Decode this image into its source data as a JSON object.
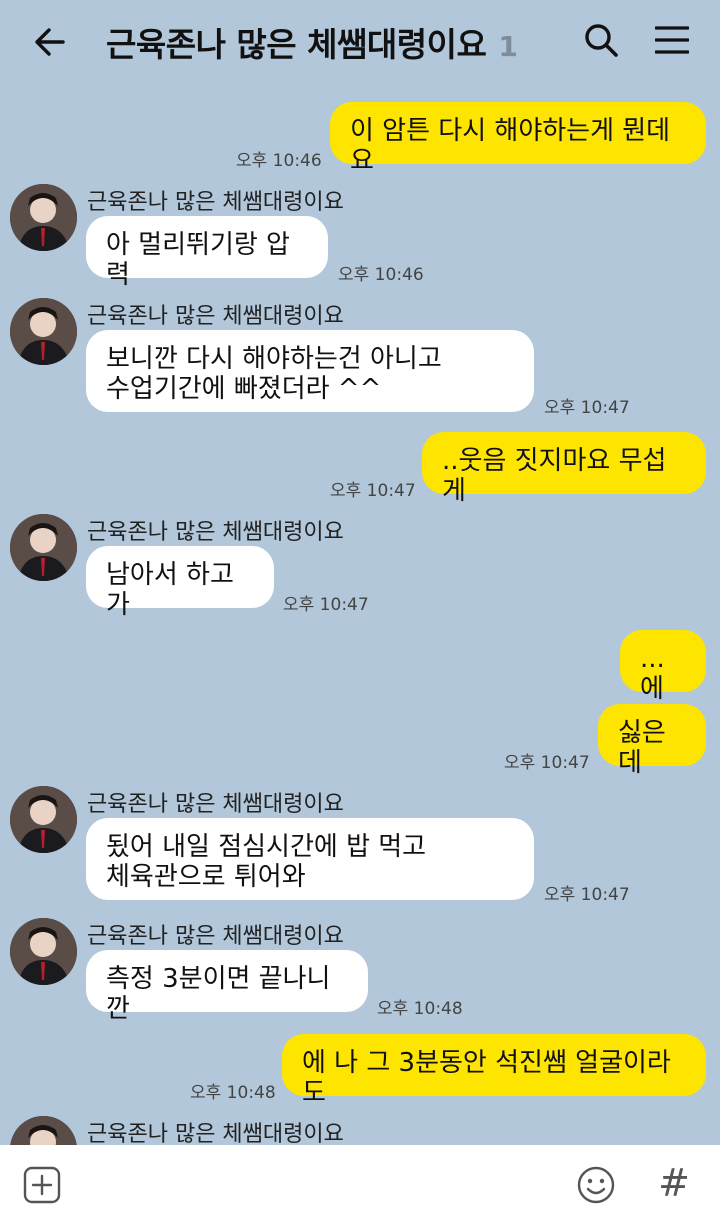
{
  "header": {
    "title": "근육존나 많은 체쌤대령이요",
    "member_count": "1"
  },
  "messages": [
    {
      "side": "me",
      "text": "이 암튼 다시 해야하는게 뭔데요",
      "time": "오후 10:46"
    },
    {
      "side": "them",
      "sender": "근육존나 많은 체쌤대령이요",
      "text": "아 멀리뛰기랑 압력",
      "time": "오후 10:46"
    },
    {
      "side": "them",
      "sender": "근육존나 많은 체쌤대령이요",
      "text": "보니깐 다시 해야하는건 아니고\n수업기간에 빠졌더라 ^^",
      "time": "오후 10:47"
    },
    {
      "side": "me",
      "text": "..웃음 짓지마요 무섭게",
      "time": "오후 10:47"
    },
    {
      "side": "them",
      "sender": "근육존나 많은 체쌤대령이요",
      "text": "남아서 하고가",
      "time": "오후 10:47"
    },
    {
      "side": "me",
      "text": "...에",
      "time": ""
    },
    {
      "side": "me",
      "text": "싫은데",
      "time": "오후 10:47"
    },
    {
      "side": "them",
      "sender": "근육존나 많은 체쌤대령이요",
      "text": "됬어 내일 점심시간에 밥 먹고\n체육관으로 튀어와",
      "time": "오후 10:47"
    },
    {
      "side": "them",
      "sender": "근육존나 많은 체쌤대령이요",
      "text": "측정 3분이면 끝나니깐",
      "time": "오후 10:48"
    },
    {
      "side": "me",
      "text": "에 나 그 3분동안 석진쌤 얼굴이라도",
      "time": "오후 10:48"
    },
    {
      "side": "them",
      "sender": "근육존나 많은 체쌤대령이요",
      "text": "",
      "time": ""
    }
  ],
  "input": {
    "placeholder": ""
  },
  "icons": {
    "back": "arrow-left-icon",
    "search": "search-icon",
    "menu": "hamburger-menu-icon",
    "plus": "plus-square-icon",
    "emoji": "smiley-icon",
    "hash": "#"
  },
  "colors": {
    "background": "#b2c7da",
    "my_bubble": "#fee500",
    "their_bubble": "#ffffff"
  }
}
